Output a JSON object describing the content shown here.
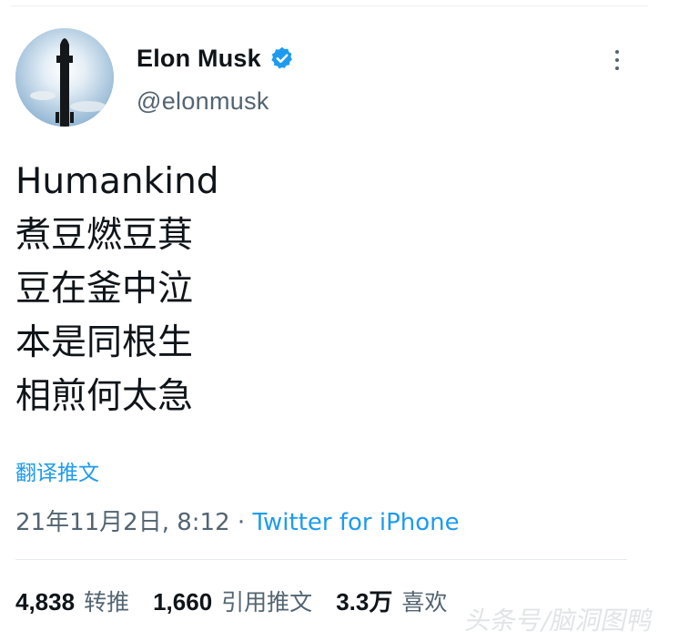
{
  "author": {
    "display_name": "Elon Musk",
    "handle": "@elonmusk",
    "verified": true
  },
  "tweet": {
    "lines": [
      "Humankind",
      "煮豆燃豆萁",
      "豆在釜中泣",
      "本是同根生",
      "相煎何太急"
    ],
    "translate_label": "翻译推文",
    "timestamp": "21年11月2日, 8:12",
    "separator": " · ",
    "source": "Twitter for iPhone"
  },
  "stats": {
    "retweets": {
      "count": "4,838",
      "label": "转推"
    },
    "quotes": {
      "count": "1,660",
      "label": "引用推文"
    },
    "likes": {
      "count": "3.3万",
      "label": "喜欢"
    }
  },
  "watermark": "头条号/脑洞图鸭",
  "colors": {
    "link_blue": "#1d9bf0",
    "secondary_text": "#536471",
    "primary_text": "#0f1419"
  },
  "icons": {
    "verified": "verified-badge-icon",
    "more": "more-options-icon"
  }
}
